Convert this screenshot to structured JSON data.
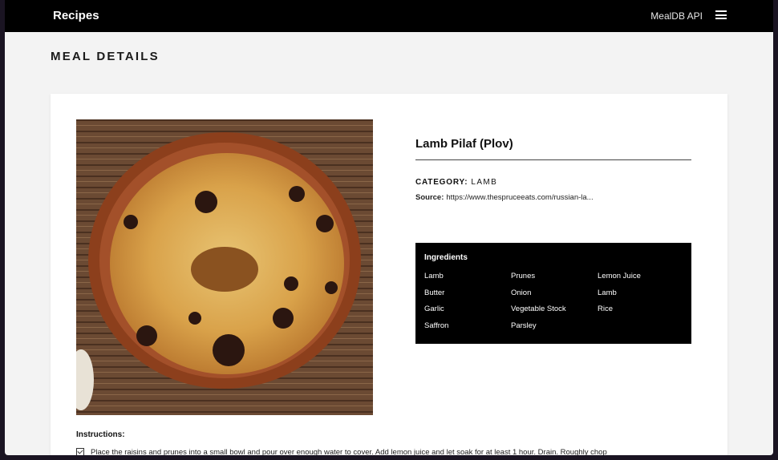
{
  "navbar": {
    "brand": "Recipes",
    "api_link": "MealDB API",
    "menu_icon": "hamburger-menu-icon"
  },
  "page": {
    "title": "MEAL DETAILS"
  },
  "meal": {
    "name": "Lamb Pilaf (Plov)",
    "category_label": "CATEGORY:",
    "category_value": "LAMB",
    "source_label": "Source:",
    "source_value": "https://www.thespruceeats.com/russian-la..."
  },
  "ingredients": {
    "title": "Ingredients",
    "items": [
      "Lamb",
      "Prunes",
      "Lemon Juice",
      "Butter",
      "Onion",
      "Lamb",
      "Garlic",
      "Vegetable Stock",
      "Rice",
      "Saffron",
      "Parsley"
    ]
  },
  "instructions": {
    "label": "Instructions:",
    "steps": [
      "Place the raisins and prunes into a small bowl and pour over enough water to cover. Add lemon juice and let soak for at least 1 hour. Drain. Roughly chop"
    ]
  },
  "colors": {
    "navbar_bg": "#000000",
    "page_bg": "#f3f3f3",
    "card_bg": "#ffffff",
    "ingredients_bg": "#000000"
  }
}
